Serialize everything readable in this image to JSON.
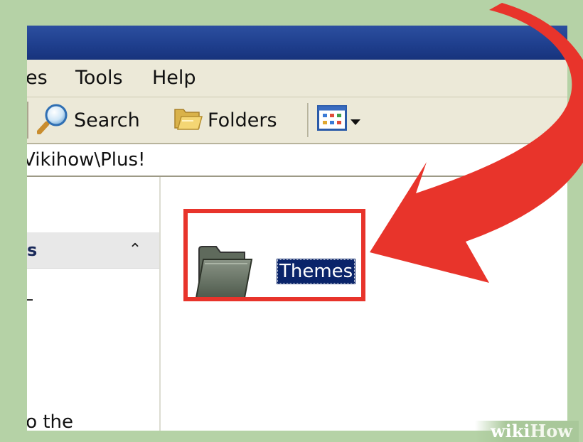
{
  "menu": {
    "items": [
      {
        "label": "es"
      },
      {
        "label": "Tools"
      },
      {
        "label": "Help"
      }
    ]
  },
  "toolbar": {
    "search_label": "Search",
    "folders_label": "Folders"
  },
  "address": {
    "path": "Vikihow\\Plus!"
  },
  "tasks": {
    "header_title": "s",
    "collapse_glyph": "⌃",
    "text": "to the"
  },
  "content": {
    "folders": [
      {
        "label": "Themes",
        "selected": true
      }
    ]
  },
  "watermark": {
    "part1": "wiki",
    "part2": "How"
  },
  "icons": [
    "search-icon",
    "folders-icon",
    "views-icon",
    "chevron-down-icon",
    "folder-icon",
    "collapse-icon"
  ],
  "colors": {
    "title_bar": "#2c4f9f",
    "chrome": "#ece9d8",
    "selection": "#0a246a",
    "highlight": "#e8342b",
    "background": "#b5d2a6"
  }
}
